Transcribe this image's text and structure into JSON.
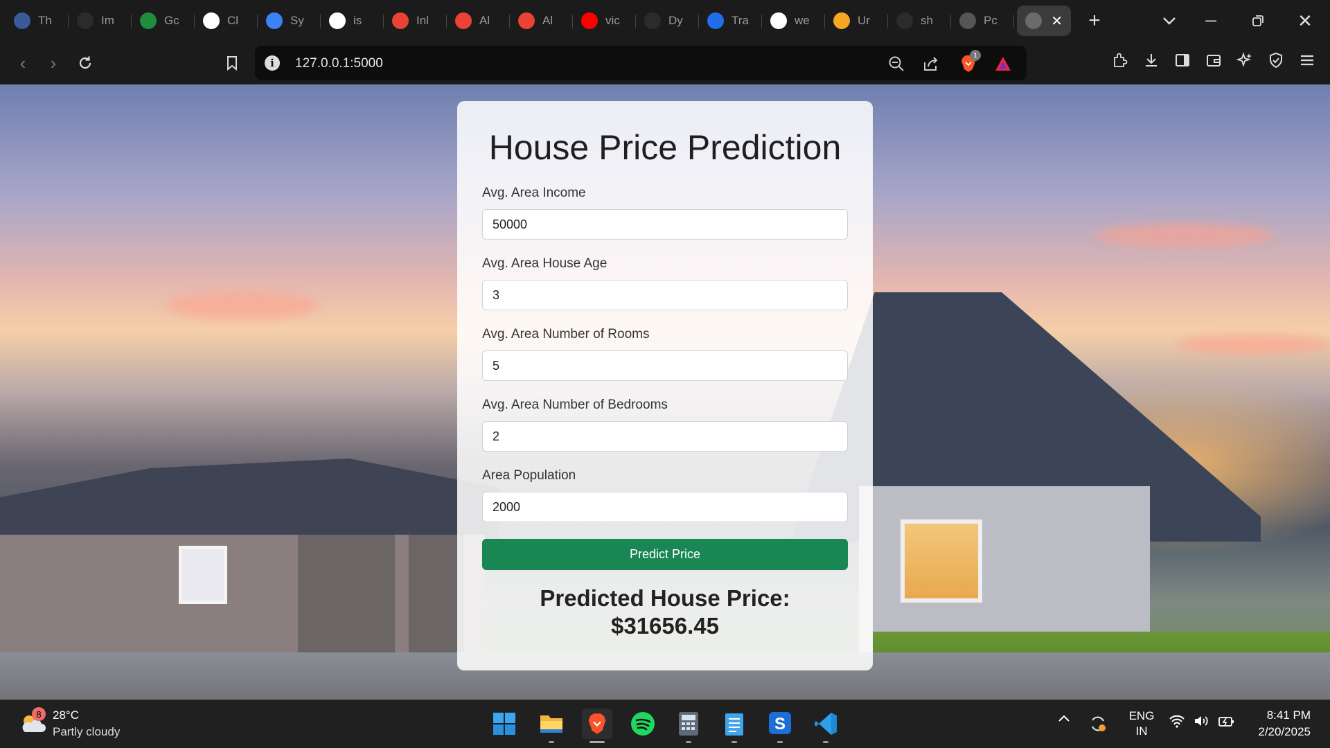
{
  "browser": {
    "tabs": [
      {
        "title": "Th",
        "icon": "gear-favicon",
        "color": "#3a5a9a"
      },
      {
        "title": "Im",
        "icon": "openai-favicon",
        "color": "#2b2b2b"
      },
      {
        "title": "Gc",
        "icon": "google-meet-favicon",
        "color": "#1e8e3e"
      },
      {
        "title": "Cl",
        "icon": "google-favicon",
        "color": "#ffffff"
      },
      {
        "title": "Sy",
        "icon": "contacts-favicon",
        "color": "#3b82f6"
      },
      {
        "title": "is",
        "icon": "google-favicon",
        "color": "#ffffff"
      },
      {
        "title": "Inl",
        "icon": "gmail-favicon",
        "color": "#ea4335"
      },
      {
        "title": "Al",
        "icon": "gmail-favicon",
        "color": "#ea4335"
      },
      {
        "title": "Al",
        "icon": "gmail-favicon",
        "color": "#ea4335"
      },
      {
        "title": "vic",
        "icon": "youtube-favicon",
        "color": "#ff0000"
      },
      {
        "title": "Dy",
        "icon": "openai-favicon",
        "color": "#2b2b2b"
      },
      {
        "title": "Tra",
        "icon": "k-favicon",
        "color": "#1f6feb"
      },
      {
        "title": "we",
        "icon": "google-favicon",
        "color": "#ffffff"
      },
      {
        "title": "Ur",
        "icon": "coursera-favicon",
        "color": "#f5a623"
      },
      {
        "title": "sh",
        "icon": "github-favicon",
        "color": "#2b2b2b"
      },
      {
        "title": "Pc",
        "icon": "globe-favicon",
        "color": "#555555"
      }
    ],
    "active_tab": {
      "title": "",
      "icon": "globe-favicon"
    },
    "url": "127.0.0.1:5000",
    "brave_badge": "1"
  },
  "page": {
    "title": "House Price Prediction",
    "fields": [
      {
        "label": "Avg. Area Income",
        "value": "50000"
      },
      {
        "label": "Avg. Area House Age",
        "value": "3"
      },
      {
        "label": "Avg. Area Number of Rooms",
        "value": "5"
      },
      {
        "label": "Avg. Area Number of Bedrooms",
        "value": "2"
      },
      {
        "label": "Area Population",
        "value": "2000"
      }
    ],
    "button_label": "Predict Price",
    "result_label": "Predicted House Price:",
    "result_value": "$31656.45",
    "accent_color": "#198754"
  },
  "taskbar": {
    "weather_badge": "8",
    "temperature": "28°C",
    "condition": "Partly cloudy",
    "apps": [
      "start",
      "file-explorer",
      "brave",
      "spotify",
      "calculator",
      "notepad",
      "sublime",
      "vscode"
    ],
    "language": "ENG",
    "region": "IN",
    "time": "8:41 PM",
    "date": "2/20/2025"
  }
}
